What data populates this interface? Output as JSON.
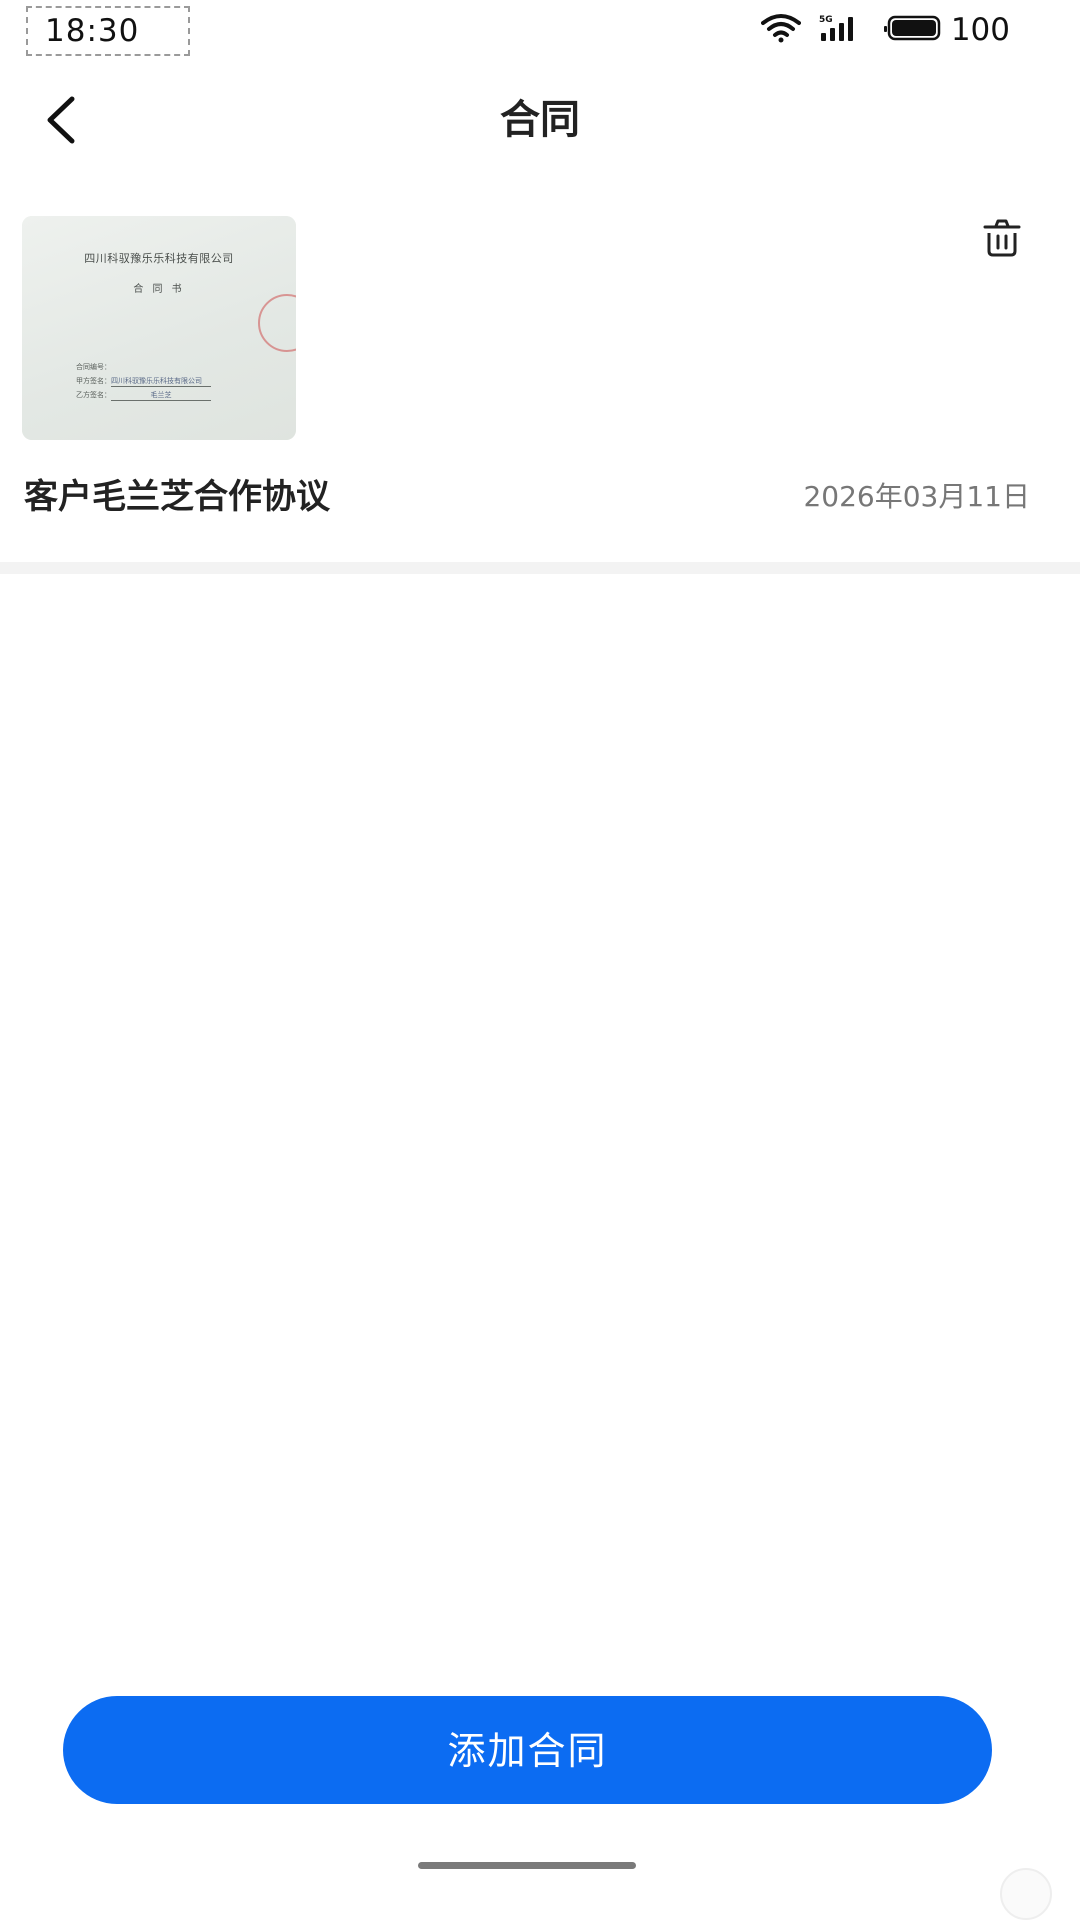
{
  "status_bar": {
    "time": "18:30",
    "network": "5G",
    "battery": "100"
  },
  "nav": {
    "title": "合同",
    "back_icon": "chevron-left-icon"
  },
  "contract": {
    "name": "客户毛兰芝合作协议",
    "date": "2026年03月11日",
    "delete_icon": "trash-icon",
    "thumbnail": {
      "heading": "四川科驭豫乐乐科技有限公司",
      "subheading": "合 同 书",
      "line1_label": "合同编号：",
      "line2_label": "甲方签名：",
      "line2_value": "四川科驭豫乐乐科技有限公司",
      "line3_label": "乙方签名：",
      "line3_value": "毛兰芝"
    }
  },
  "actions": {
    "add_contract": "添加合同"
  },
  "colors": {
    "primary": "#0c6cf2",
    "title_text": "#222222",
    "secondary_text": "#777777",
    "divider": "#f3f3f3"
  }
}
